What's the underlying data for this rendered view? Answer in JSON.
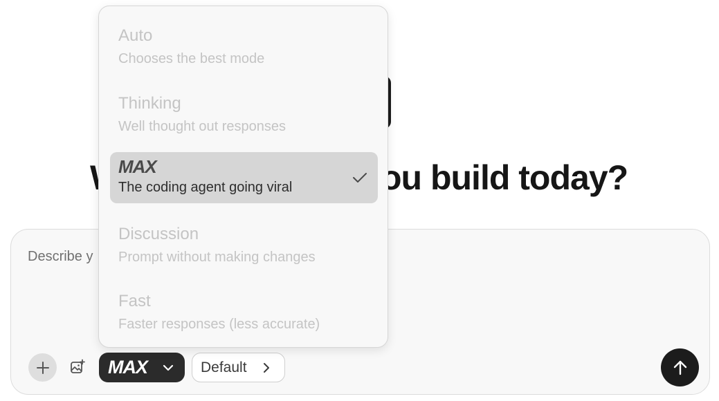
{
  "headline": {
    "partial_left": "W",
    "partial_right": "ou build today?"
  },
  "composer": {
    "placeholder": "Describe y"
  },
  "toolbar": {
    "mode_label": "MAX",
    "default_label": "Default",
    "icons": {
      "plus": "plus-icon",
      "image": "image-add-icon",
      "mode_chevron": "chevron-down-icon",
      "default_chevron": "chevron-right-icon",
      "send": "arrow-up-icon"
    }
  },
  "mode_menu": {
    "items": [
      {
        "title": "Auto",
        "description": "Chooses the best mode",
        "selected": false
      },
      {
        "title": "Thinking",
        "description": "Well thought out responses",
        "selected": false
      },
      {
        "title": "MAX",
        "description": "The coding agent going viral",
        "selected": true
      },
      {
        "title": "Discussion",
        "description": "Prompt without making changes",
        "selected": false
      },
      {
        "title": "Fast",
        "description": "Faster responses (less accurate)",
        "selected": false
      }
    ],
    "selected_icon": "check-icon"
  },
  "colors": {
    "background": "#ffffff",
    "composer_bg": "#f8f8f8",
    "dark_button": "#2b2b2b",
    "send_button": "#1c1c1c",
    "menu_selected_bg": "#d6d6d6",
    "menu_muted_text": "#c4c4c4"
  }
}
